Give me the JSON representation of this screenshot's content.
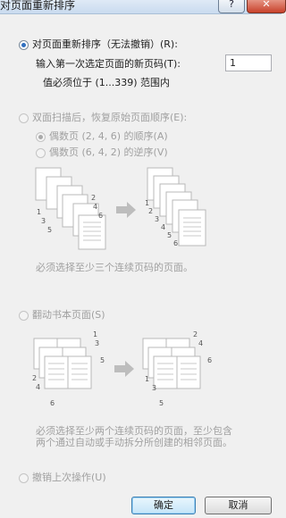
{
  "window": {
    "title": "对页面重新排序",
    "help_glyph": "?",
    "close_glyph": "✕"
  },
  "option_reorder": {
    "label": "对页面重新排序（无法撤销）(R):",
    "prompt": "输入第一次选定页面的新页码(T):",
    "value": "1",
    "range_note": "值必须位于 (1...339) 范围内"
  },
  "option_duplex": {
    "label": "双面扫描后，恢复原始页面顺序(E):",
    "even_order": "偶数页 (2, 4, 6) 的顺序(A)",
    "even_reverse": "偶数页 (6, 4, 2) 的逆序(V)",
    "note": "必须选择至少三个连续页码的页面。",
    "before_numbers": [
      "1",
      "2",
      "3",
      "4",
      "5",
      "6"
    ],
    "after_numbers": [
      "1",
      "2",
      "3",
      "4",
      "5",
      "6"
    ]
  },
  "option_flip": {
    "label": "翻动书本页面(S)",
    "note_line1": "必须选择至少两个连续页码的页面，至少包含",
    "note_line2": "两个通过自动或手动拆分所创建的相邻页面。",
    "before_numbers": [
      "1",
      "2",
      "3",
      "4",
      "5",
      "6"
    ],
    "after_numbers": [
      "1",
      "2",
      "3",
      "4",
      "5",
      "6"
    ]
  },
  "option_undo": {
    "label": "撤销上次操作(U)"
  },
  "buttons": {
    "ok": "确定",
    "cancel": "取消"
  },
  "colors": {
    "radio_selected": "#2f6fbf",
    "disabled_text": "#a0a0a0",
    "arrow": "#bdbdbd"
  }
}
